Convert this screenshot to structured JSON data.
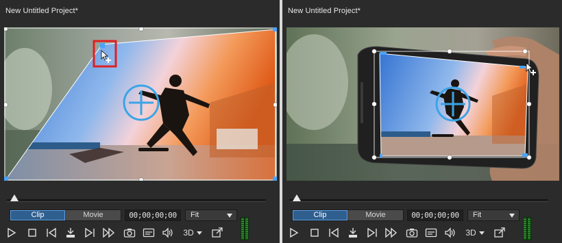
{
  "panels": [
    {
      "title": "New Untitled Project*",
      "tabs": {
        "clip": "Clip",
        "movie": "Movie",
        "active": "clip"
      },
      "timecode": "00;00;00;00",
      "fit": "Fit",
      "three_d": "3D"
    },
    {
      "title": "New Untitled Project*",
      "tabs": {
        "clip": "Clip",
        "movie": "Movie",
        "active": "clip"
      },
      "timecode": "00;00;00;00",
      "fit": "Fit",
      "three_d": "3D"
    }
  ],
  "colors": {
    "panel_bg": "#2b2b2b",
    "accent": "#3ba4e6",
    "highlight_box": "#e02020",
    "handle": "#4aa3ff"
  },
  "icons": [
    "play-icon",
    "stop-icon",
    "previous-frame-icon",
    "split-icon",
    "next-frame-icon",
    "fast-forward-icon",
    "snapshot-icon",
    "subtitle-icon",
    "volume-icon",
    "dropdown-icon",
    "undock-icon"
  ]
}
